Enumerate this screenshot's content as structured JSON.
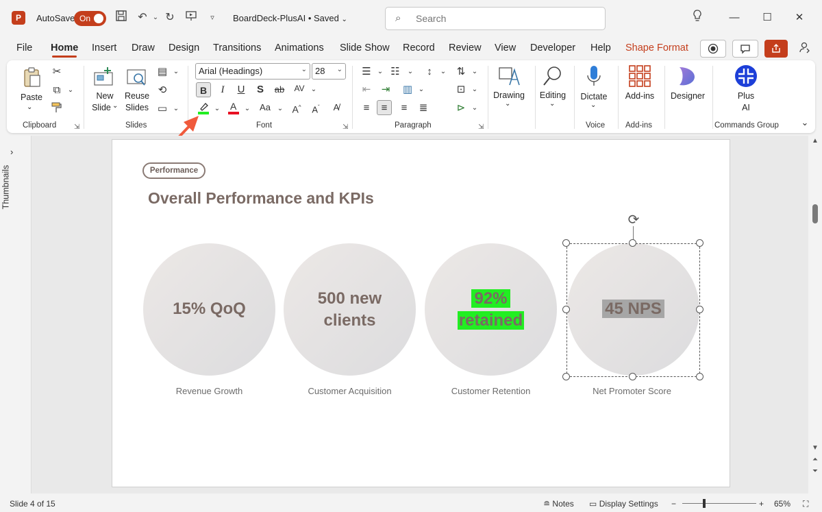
{
  "titlebar": {
    "app_letter": "P",
    "autosave_label": "AutoSave",
    "autosave_state": "On",
    "doc_title": "BoardDeck-PlusAI • Saved",
    "search_placeholder": "Search"
  },
  "tabs": [
    "File",
    "Home",
    "Insert",
    "Draw",
    "Design",
    "Transitions",
    "Animations",
    "Slide Show",
    "Record",
    "Review",
    "View",
    "Developer",
    "Help",
    "Shape Format"
  ],
  "ribbon": {
    "clipboard": {
      "paste": "Paste",
      "group": "Clipboard"
    },
    "slides": {
      "new_slide_1": "New",
      "new_slide_2": "Slide",
      "reuse_1": "Reuse",
      "reuse_2": "Slides",
      "group": "Slides"
    },
    "font": {
      "family": "Arial (Headings)",
      "size": "28",
      "group": "Font",
      "highlight_color": "#22ee22",
      "font_color": "#e81123"
    },
    "paragraph": {
      "group": "Paragraph"
    },
    "drawing": "Drawing",
    "editing": "Editing",
    "voice": {
      "dictate": "Dictate",
      "group": "Voice"
    },
    "addins": {
      "label": "Add-ins",
      "group": "Add-ins"
    },
    "designer": "Designer",
    "plusai": {
      "label_1": "Plus",
      "label_2": "AI",
      "group": "Commands Group"
    }
  },
  "thumbnails_label": "Thumbnails",
  "slide": {
    "tag": "Performance",
    "title": "Overall Performance and KPIs",
    "kpis": [
      {
        "line1": "15% QoQ",
        "line2": "",
        "label": "Revenue Growth"
      },
      {
        "line1": "500 new",
        "line2": "clients",
        "label": "Customer Acquisition"
      },
      {
        "line1": "92%",
        "line2": "retained",
        "label": "Customer Retention"
      },
      {
        "line1": "45 NPS",
        "line2": "",
        "label": "Net Promoter Score"
      }
    ]
  },
  "status": {
    "slide_counter": "Slide 4 of 15",
    "notes": "Notes",
    "display_settings": "Display Settings",
    "zoom": "65%"
  },
  "colors": {
    "accent": "#c43e1c",
    "highlight": "#22ee22"
  }
}
